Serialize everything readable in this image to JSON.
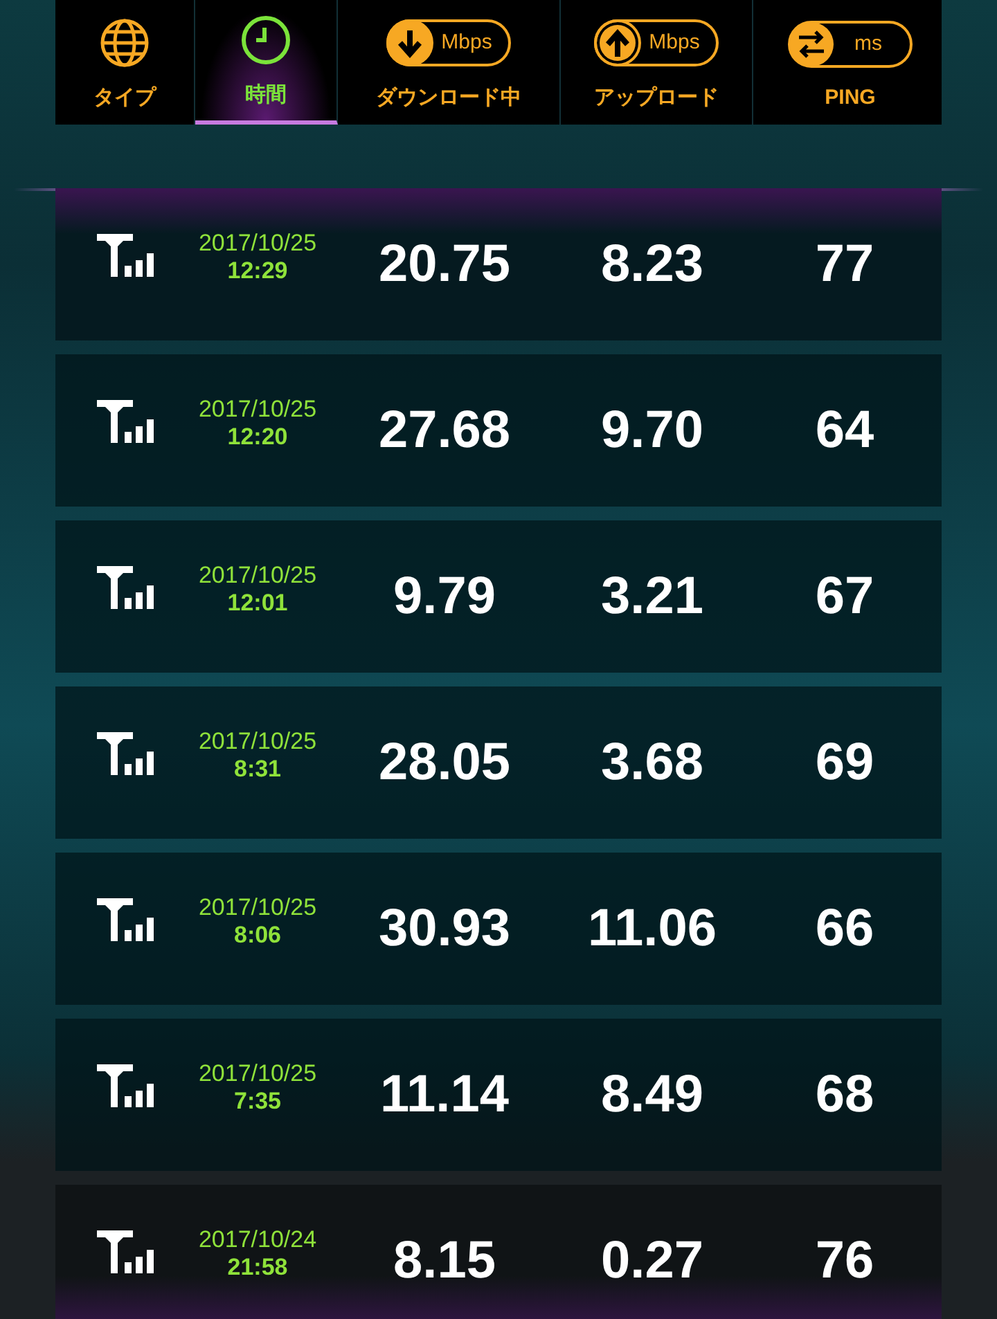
{
  "tabs": [
    {
      "kind": "globe",
      "label": "タイプ",
      "selected": false
    },
    {
      "kind": "clock",
      "label": "時間",
      "selected": true
    },
    {
      "kind": "down",
      "unit": "Mbps",
      "label": "ダウンロード中",
      "selected": false
    },
    {
      "kind": "up",
      "unit": "Mbps",
      "label": "アップロード",
      "selected": false
    },
    {
      "kind": "ping",
      "unit": "ms",
      "label": "PING",
      "selected": false
    }
  ],
  "results": [
    {
      "date": "2017/10/25",
      "time": "12:29",
      "download": "20.75",
      "upload": "8.23",
      "ping": "77"
    },
    {
      "date": "2017/10/25",
      "time": "12:20",
      "download": "27.68",
      "upload": "9.70",
      "ping": "64"
    },
    {
      "date": "2017/10/25",
      "time": "12:01",
      "download": "9.79",
      "upload": "3.21",
      "ping": "67"
    },
    {
      "date": "2017/10/25",
      "time": "8:31",
      "download": "28.05",
      "upload": "3.68",
      "ping": "69"
    },
    {
      "date": "2017/10/25",
      "time": "8:06",
      "download": "30.93",
      "upload": "11.06",
      "ping": "66"
    },
    {
      "date": "2017/10/25",
      "time": "7:35",
      "download": "11.14",
      "upload": "8.49",
      "ping": "68"
    },
    {
      "date": "2017/10/24",
      "time": "21:58",
      "download": "8.15",
      "upload": "0.27",
      "ping": "76"
    }
  ]
}
